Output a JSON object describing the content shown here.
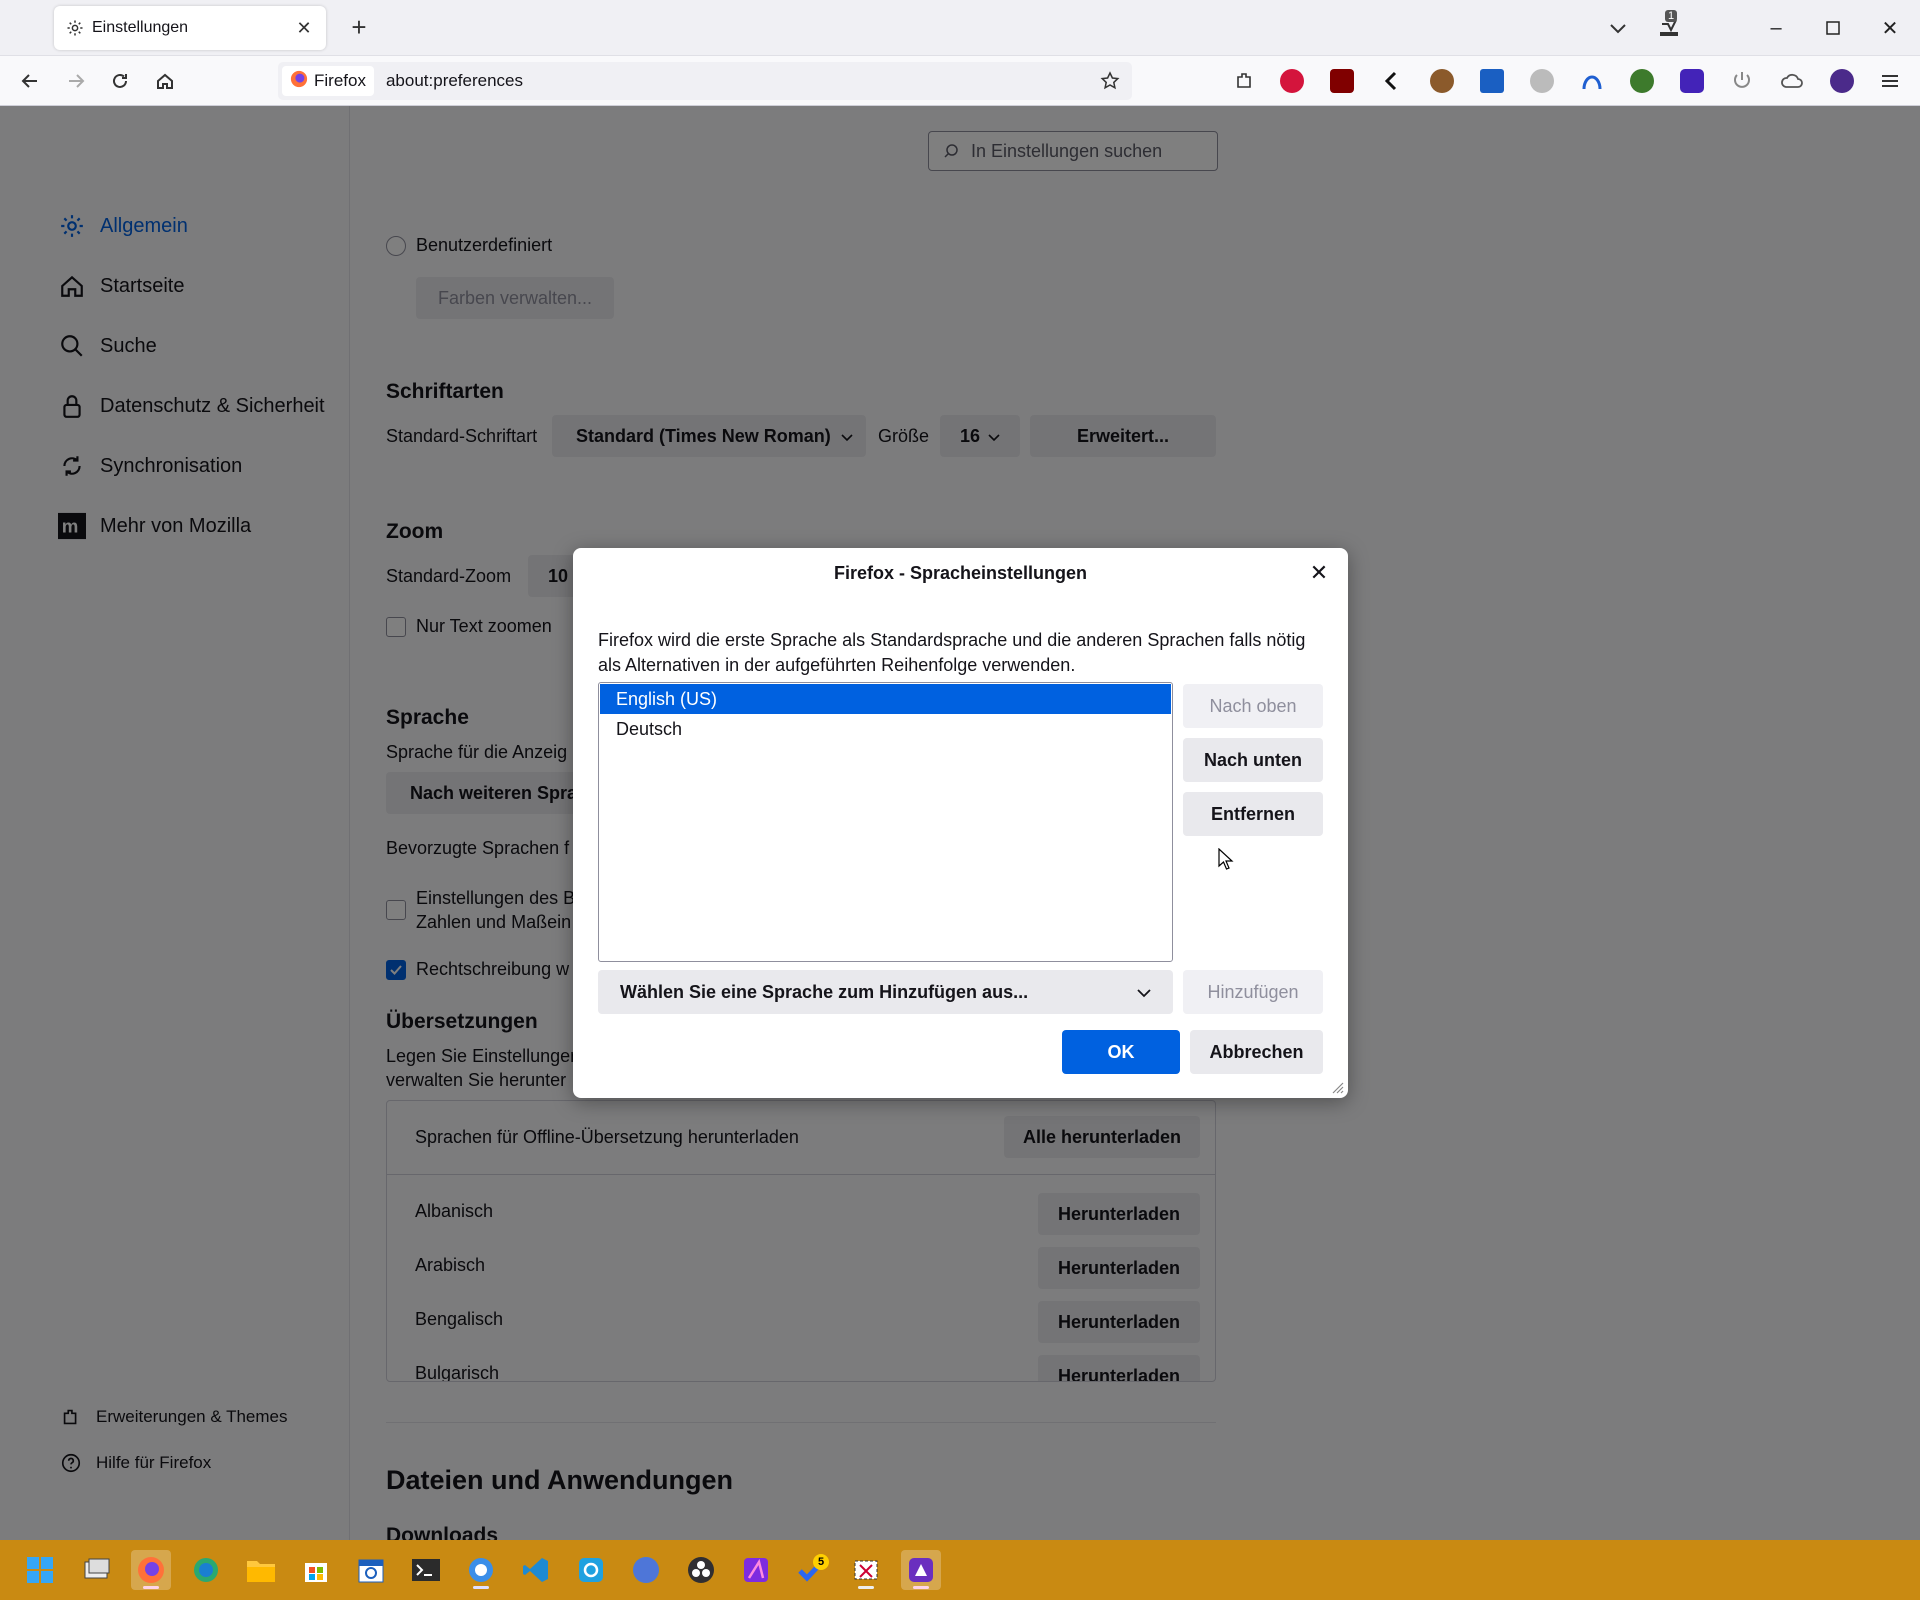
{
  "browser": {
    "tab_title": "Einstellungen",
    "identity_label": "Firefox",
    "url": "about:preferences",
    "tab_count_badge": "1"
  },
  "sidebar": {
    "items": [
      {
        "label": "Allgemein",
        "icon": "gear-icon",
        "selected": true
      },
      {
        "label": "Startseite",
        "icon": "home-icon"
      },
      {
        "label": "Suche",
        "icon": "search-icon"
      },
      {
        "label": "Datenschutz & Sicherheit",
        "icon": "lock-icon"
      },
      {
        "label": "Synchronisation",
        "icon": "sync-icon"
      },
      {
        "label": "Mehr von Mozilla",
        "icon": "mozilla-icon"
      }
    ],
    "footer": [
      {
        "label": "Erweiterungen & Themes",
        "icon": "puzzle-icon"
      },
      {
        "label": "Hilfe für Firefox",
        "icon": "help-icon"
      }
    ]
  },
  "main": {
    "search_placeholder": "In Einstellungen suchen",
    "colors": {
      "radio_label": "Benutzerdefiniert",
      "manage_button": "Farben verwalten..."
    },
    "fonts": {
      "heading": "Schriftarten",
      "default_label": "Standard-Schriftart",
      "default_value": "Standard (Times New Roman)",
      "size_label": "Größe",
      "size_value": "16",
      "advanced_button": "Erweitert..."
    },
    "zoom": {
      "heading": "Zoom",
      "default_label": "Standard-Zoom",
      "default_value": "10",
      "text_only_label": "Nur Text zoomen"
    },
    "language": {
      "heading": "Sprache",
      "display_label": "Sprache für die Anzeig",
      "search_more_button": "Nach weiteren Spra",
      "preferred_label": "Bevorzugte Sprachen f",
      "locale_line1": "Einstellungen des B",
      "locale_line2": "Zahlen und Maßein",
      "spellcheck_label": "Rechtschreibung w"
    },
    "translations": {
      "heading": "Übersetzungen",
      "desc_line1": "Legen Sie Einstellungen",
      "desc_line2": "verwalten Sie herunter",
      "offline_label": "Sprachen für Offline-Übersetzung herunterladen",
      "download_all_button": "Alle herunterladen",
      "languages": [
        {
          "name": "Albanisch",
          "button": "Herunterladen"
        },
        {
          "name": "Arabisch",
          "button": "Herunterladen"
        },
        {
          "name": "Bengalisch",
          "button": "Herunterladen"
        },
        {
          "name": "Bulgarisch",
          "button": "Herunterladen"
        }
      ]
    },
    "files": {
      "heading": "Dateien und Anwendungen",
      "downloads_heading": "Downloads"
    }
  },
  "dialog": {
    "title": "Firefox - Spracheinstellungen",
    "description": "Firefox wird die erste Sprache als Standardsprache und die anderen Sprachen falls nötig als Alternativen in der aufgeführten Reihenfolge verwenden.",
    "languages": [
      "English (US)",
      "Deutsch"
    ],
    "move_up_button": "Nach oben",
    "move_down_button": "Nach unten",
    "remove_button": "Entfernen",
    "add_select": "Wählen Sie eine Sprache zum Hinzufügen aus...",
    "add_button": "Hinzufügen",
    "ok_button": "OK",
    "cancel_button": "Abbrechen"
  },
  "taskbar": {
    "badge_count": "5"
  },
  "colors": {
    "accent": "#0061e0",
    "taskbar": "#c98a12"
  }
}
